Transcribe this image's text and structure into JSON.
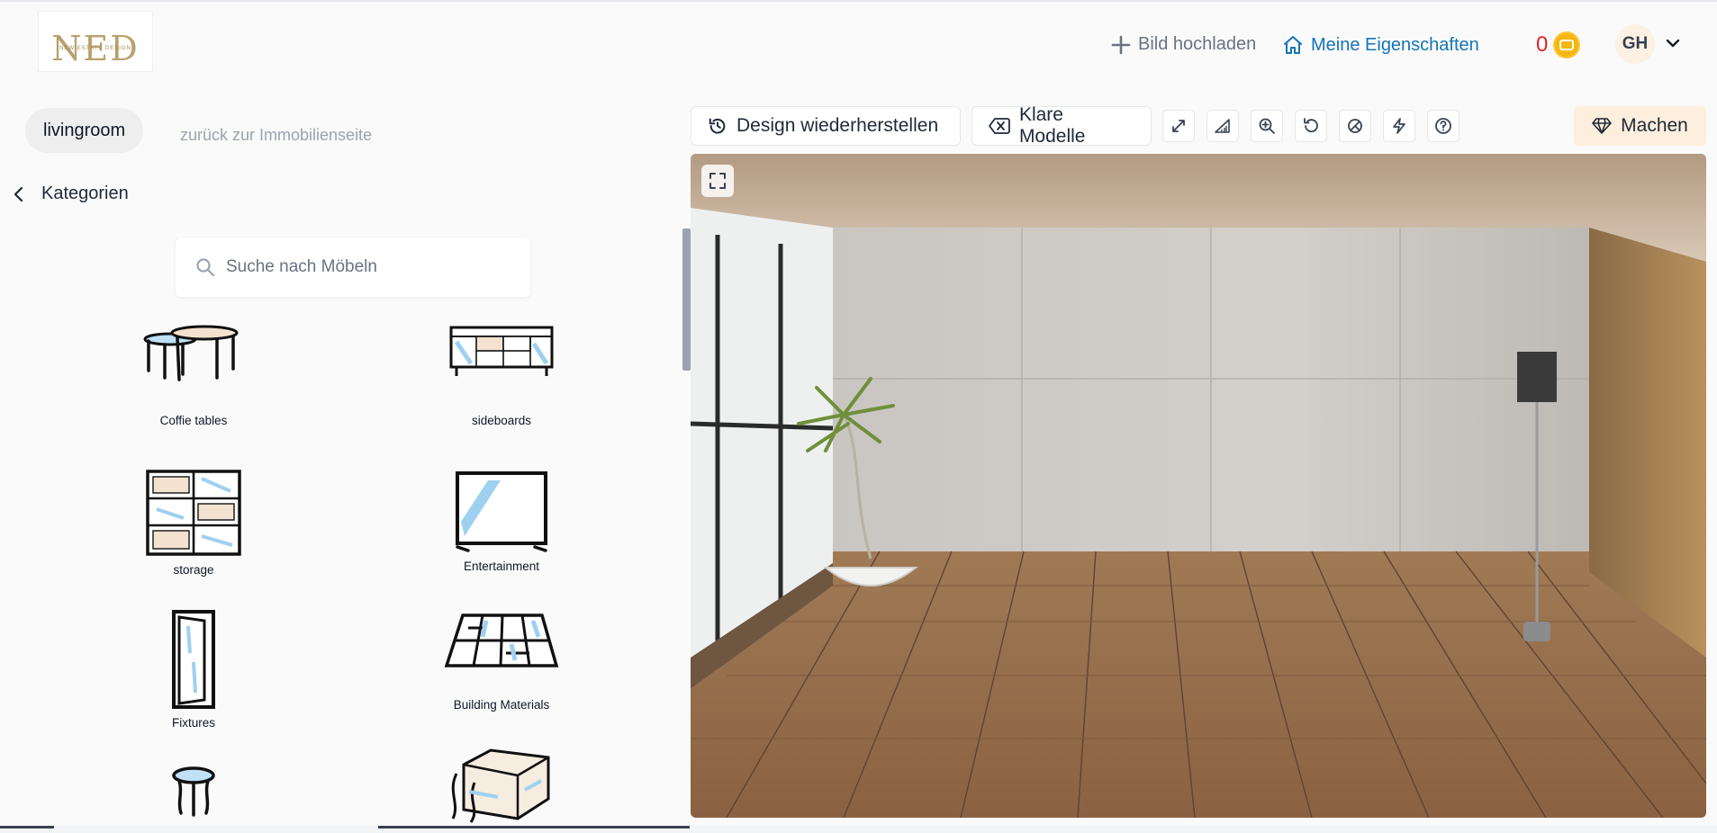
{
  "header": {
    "logo_text": "NED",
    "logo_sub": "NEW ESTATE DESIGN",
    "upload_label": "Bild hochladen",
    "properties_label": "Meine Eigenschaften",
    "credits": "0",
    "avatar_initials": "GH",
    "colors": {
      "link": "#1574b8",
      "credits": "#dc2626",
      "coin": "#f5b60d"
    }
  },
  "sidebar": {
    "room_tab": "livingroom",
    "back_link": "zurück zur Immobilienseite",
    "categories_label": "Kategorien",
    "search_placeholder": "Suche nach Möbeln",
    "categories": [
      {
        "label": "Coffie tables",
        "icon": "coffee-table-icon"
      },
      {
        "label": "sideboards",
        "icon": "sideboard-icon"
      },
      {
        "label": "storage",
        "icon": "storage-icon"
      },
      {
        "label": "Entertainment",
        "icon": "tv-icon"
      },
      {
        "label": "Fixtures",
        "icon": "door-icon"
      },
      {
        "label": "Building Materials",
        "icon": "floor-tiles-icon"
      },
      {
        "label": "",
        "icon": "side-table-icon"
      },
      {
        "label": "",
        "icon": "ottoman-icon"
      }
    ]
  },
  "toolbar": {
    "restore_label": "Design wiederherstellen",
    "clear_label": "Klare Modelle",
    "make_label": "Machen",
    "tools": [
      "resize-icon",
      "measure-icon",
      "zoom-in-icon",
      "undo-icon",
      "magic-icon",
      "lightning-icon",
      "help-icon"
    ]
  }
}
